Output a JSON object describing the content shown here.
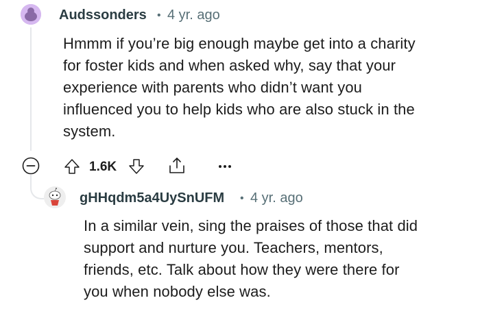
{
  "comment1": {
    "author": "Audssonders",
    "separator": "•",
    "time": "4 yr. ago",
    "body_lines": [
      "Hmmm if you’re big enough maybe get into a charity",
      "for foster kids and when asked why, say that your",
      "experience with parents who didn’t want you",
      "influenced you to help kids who are also stuck in the",
      "system."
    ],
    "votes": "1.6K",
    "avatar_icon": "reddit-avatar-icon",
    "collapse_icon": "collapse-minus-icon",
    "upvote_icon": "upvote-arrow-icon",
    "downvote_icon": "downvote-arrow-icon",
    "share_icon": "share-icon",
    "more_icon": "more-options-icon"
  },
  "comment2": {
    "author": "gHHqdm5a4UySnUFM",
    "separator": "•",
    "time": "4 yr. ago",
    "body_lines": [
      "In a similar vein, sing the praises of those that did",
      "support and nurture you. Teachers, mentors,",
      "friends, etc. Talk about how they were there for",
      "you when nobody else was."
    ],
    "avatar_icon": "snoo-avatar-icon"
  }
}
